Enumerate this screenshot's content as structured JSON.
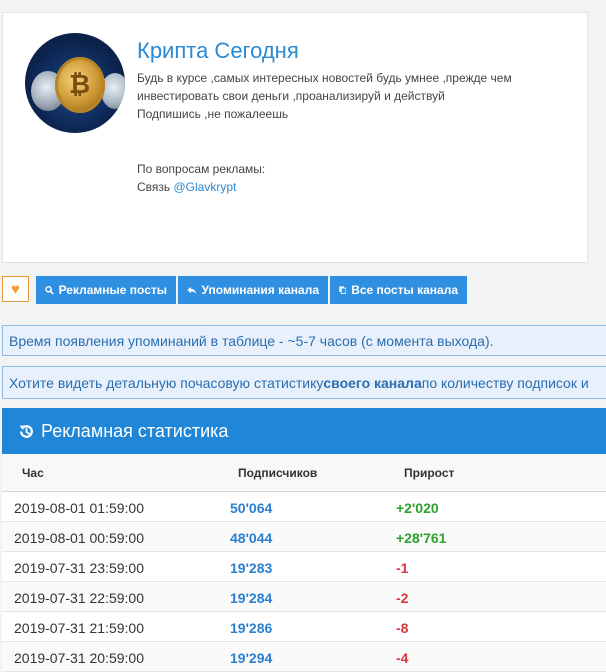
{
  "channel": {
    "title": "Крипта Сегодня",
    "description": [
      "Будь в курсе ,самых интересных новостей будь умнее ,прежде чем",
      "инвестировать свои деньги ,проанализируй и действуй",
      "Подпишись ,не пожалеешь"
    ],
    "ads_line": "По вопросам рекламы:",
    "contact_prefix": "Связь ",
    "contact_link": "@Glavkrypt"
  },
  "buttons": {
    "favorite_icon": "heart-icon",
    "ad_posts": "Рекламные посты",
    "mentions": "Упоминания канала",
    "all_posts": "Все посты канала"
  },
  "notices": {
    "mentions_time": "Время появления упоминаний в таблице - ~5-7 часов (с момента выхода).",
    "hourly_stats_prefix": "Хотите видеть детальную почасовую статистику ",
    "hourly_stats_bold": "своего канала",
    "hourly_stats_suffix": " по количеству подписок и"
  },
  "stats": {
    "title": "Рекламная статистика",
    "columns": [
      "Час",
      "Подписчиков",
      "Прирост"
    ],
    "rows": [
      {
        "time": "2019-08-01 01:59:00",
        "subs": "50'064",
        "growth": "+2'020"
      },
      {
        "time": "2019-08-01 00:59:00",
        "subs": "48'044",
        "growth": "+28'761"
      },
      {
        "time": "2019-07-31 23:59:00",
        "subs": "19'283",
        "growth": "-1"
      },
      {
        "time": "2019-07-31 22:59:00",
        "subs": "19'284",
        "growth": "-2"
      },
      {
        "time": "2019-07-31 21:59:00",
        "subs": "19'286",
        "growth": "-8"
      },
      {
        "time": "2019-07-31 20:59:00",
        "subs": "19'294",
        "growth": "-4"
      }
    ]
  },
  "colors": {
    "accent": "#1f86d8",
    "button": "#2f8fe0",
    "positive": "#2ca02c",
    "negative": "#d9363e"
  }
}
